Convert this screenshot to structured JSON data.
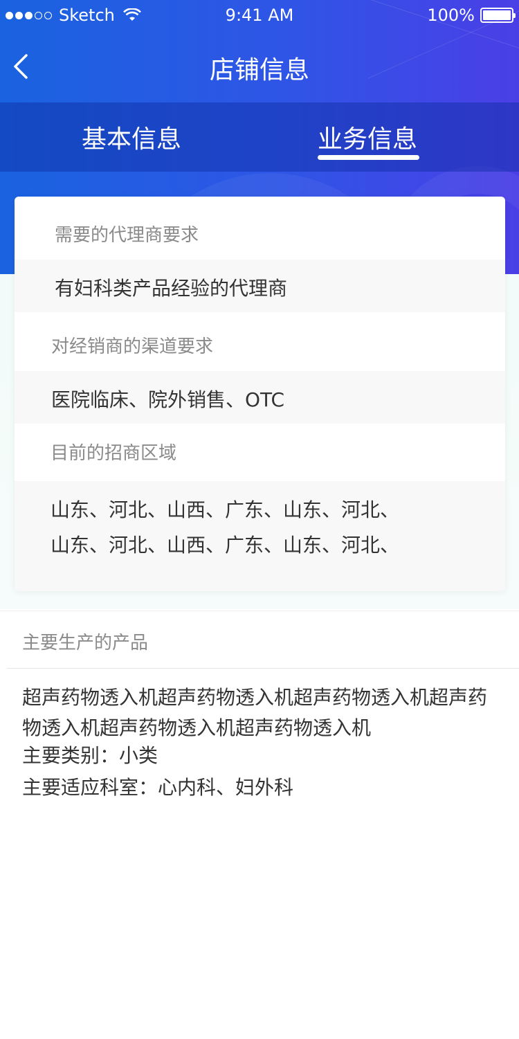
{
  "status_bar": {
    "carrier": "Sketch",
    "time": "9:41 AM",
    "battery": "100%"
  },
  "nav": {
    "title": "店铺信息"
  },
  "tabs": [
    {
      "label": "基本信息",
      "active": false
    },
    {
      "label": "业务信息",
      "active": true
    }
  ],
  "card": {
    "agent_req_label": "需要的代理商要求",
    "agent_req_value": "有妇科类产品经验的代理商",
    "channel_req_label": "对经销商的渠道要求",
    "channel_req_value": "医院临床、院外销售、OTC",
    "region_label": "目前的招商区域",
    "region_lines": [
      "山东、河北、山西、广东、山东、河北、",
      "山东、河北、山西、广东、山东、河北、"
    ]
  },
  "products": {
    "title": "主要生产的产品",
    "description": "超声药物透入机超声药物透入机超声药物透入机超声药物透入机超声药物透入机超声药物透入机",
    "category": "主要类别：小类",
    "departments": "主要适应科室：心内科、妇外科"
  },
  "colors": {
    "header_gradient_start": "#1a63e0",
    "header_gradient_end": "#4a3fe6",
    "label_gray": "#8a8a8a",
    "text_dark": "#333333"
  }
}
